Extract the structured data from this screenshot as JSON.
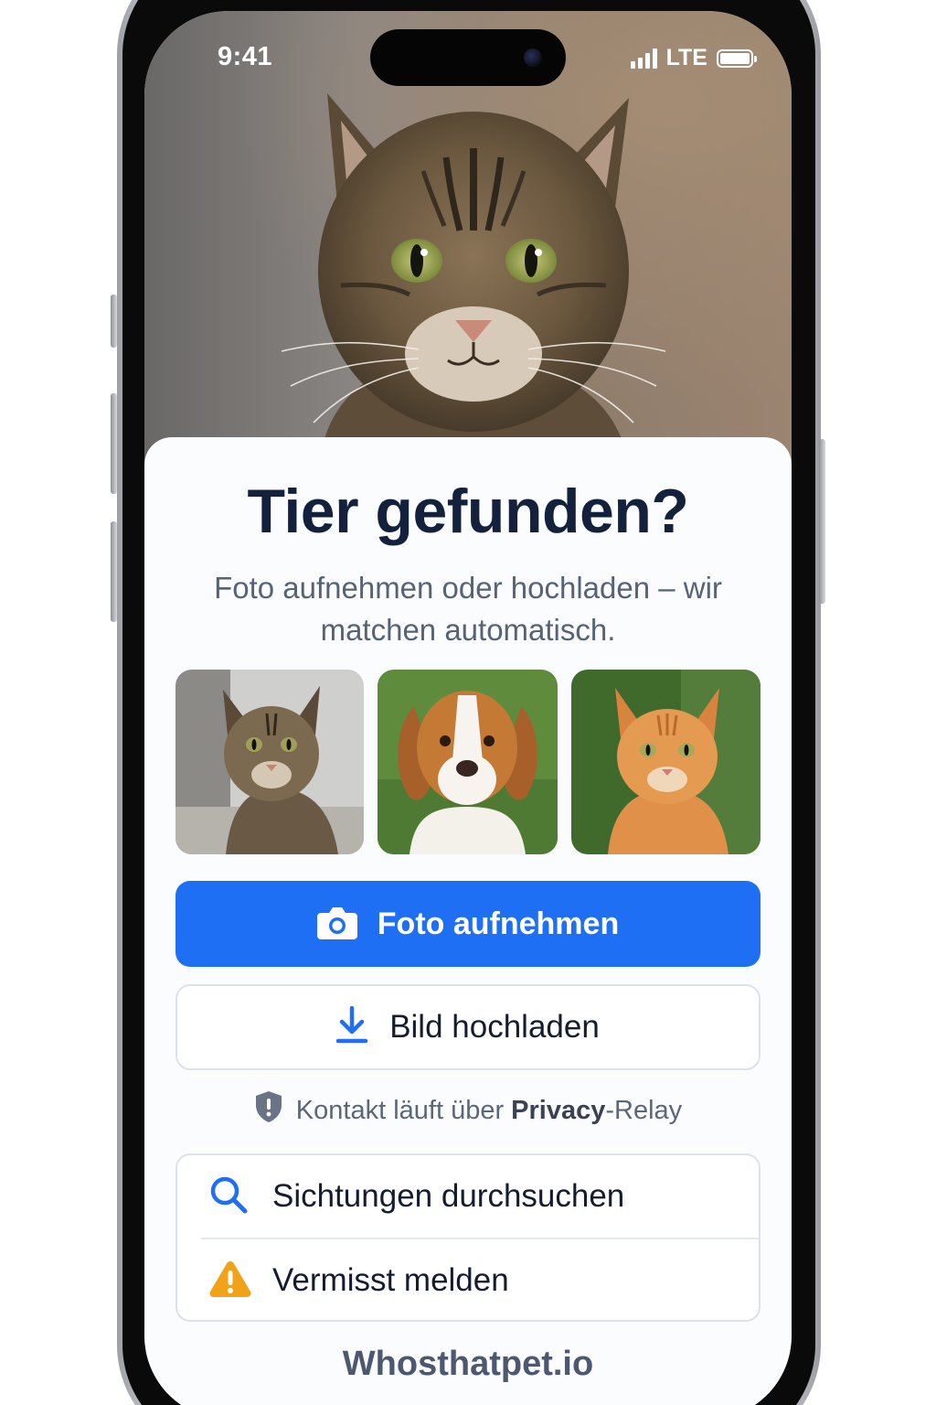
{
  "status_bar": {
    "time": "9:41",
    "network": "LTE",
    "icons": [
      "signal-icon",
      "battery-icon"
    ]
  },
  "hero": {
    "image": "tabby-cat-photo"
  },
  "sheet": {
    "title": "Tier gefunden?",
    "subtitle": "Foto aufnehmen oder hochladen – wir matchen automatisch.",
    "thumbnails": [
      {
        "image": "tabby-cat-photo"
      },
      {
        "image": "beagle-dog-photo"
      },
      {
        "image": "orange-cat-photo"
      }
    ],
    "primary_button": {
      "label": "Foto aufnehmen",
      "icon": "camera-icon",
      "color": "#1f6ff5"
    },
    "secondary_button": {
      "label": "Bild hochladen",
      "icon": "download-icon"
    },
    "privacy": {
      "prefix": "Kontakt läuft über ",
      "highlight": "Privacy",
      "suffix": "-Relay",
      "icon": "shield-icon"
    },
    "actions": [
      {
        "label": "Sichtungen durchsuchen",
        "icon": "search-icon"
      },
      {
        "label": "Vermisst melden",
        "icon": "warning-icon"
      }
    ],
    "brand": "Whosthatpet.io"
  },
  "colors": {
    "accent": "#1f6ff5",
    "title": "#14213d",
    "text_muted": "#566278",
    "warning": "#f2a219"
  }
}
